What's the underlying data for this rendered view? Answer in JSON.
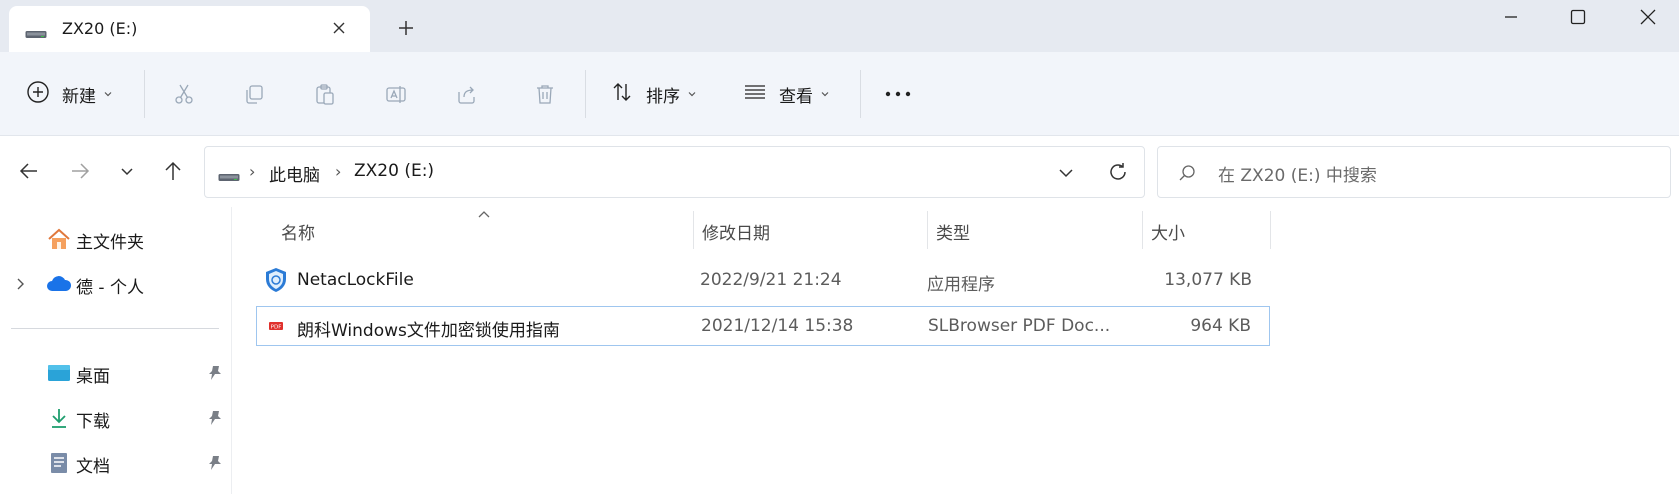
{
  "tab": {
    "title": "ZX20 (E:)"
  },
  "toolbar": {
    "new_label": "新建",
    "sort_label": "排序",
    "view_label": "查看"
  },
  "address": {
    "crumbs": [
      "此电脑",
      "ZX20 (E:)"
    ]
  },
  "search": {
    "placeholder": "在 ZX20 (E:) 中搜索"
  },
  "sidebar": {
    "items": [
      {
        "label": "主文件夹"
      },
      {
        "label": "德 - 个人"
      },
      {
        "label": "桌面"
      },
      {
        "label": "下载"
      },
      {
        "label": "文档"
      }
    ]
  },
  "columns": {
    "name": "名称",
    "modified": "修改日期",
    "type": "类型",
    "size": "大小"
  },
  "files": [
    {
      "name": "NetacLockFile",
      "modified": "2022/9/21 21:24",
      "type": "应用程序",
      "size": "13,077 KB",
      "icon": "app-shield-icon"
    },
    {
      "name": "朗科Windows文件加密锁使用指南",
      "modified": "2021/12/14 15:38",
      "type": "SLBrowser PDF Doc...",
      "size": "964 KB",
      "icon": "pdf-icon"
    }
  ],
  "colors": {
    "accent": "#0067c0",
    "titlebar": "#e6eaf1",
    "toolbar": "#f2f5fa",
    "selection_border": "#9fc6ef",
    "onedrive": "#1a73e8"
  }
}
